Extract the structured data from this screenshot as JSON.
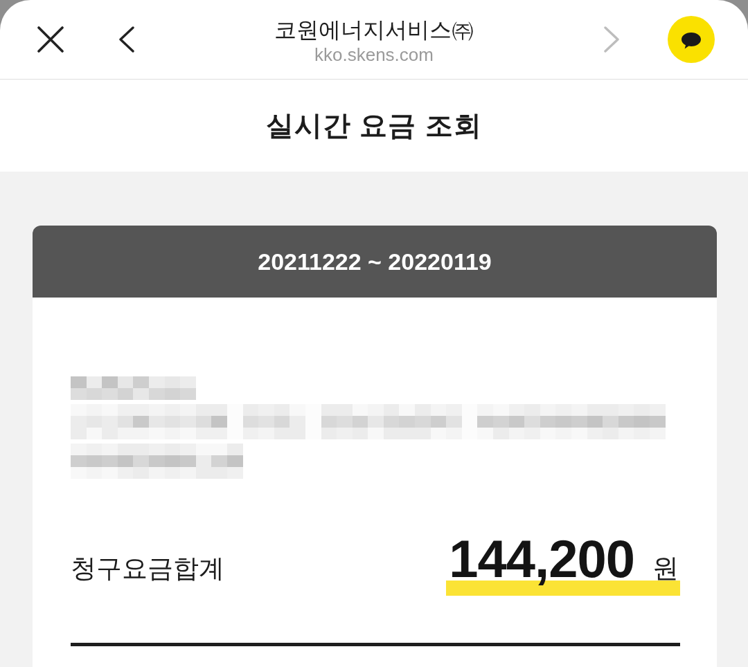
{
  "browser_bar": {
    "title": "코원에너지서비스㈜",
    "url": "kko.skens.com",
    "back": {
      "disabled": false
    },
    "forward": {
      "disabled": true
    }
  },
  "page": {
    "title": "실시간 요금 조회"
  },
  "bill_card": {
    "period": "20211222 ~ 20220119",
    "total_label": "청구요금합계",
    "total_amount": "144,200",
    "currency": "원"
  }
}
